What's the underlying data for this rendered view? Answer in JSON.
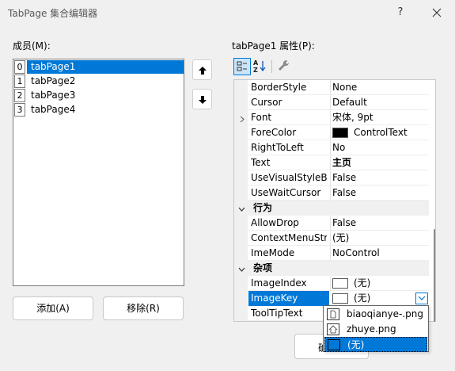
{
  "window": {
    "title": "TabPage 集合编辑器",
    "help_label": "?"
  },
  "members": {
    "label": "成员(M):",
    "items": [
      {
        "index": "0",
        "name": "tabPage1",
        "selected": true
      },
      {
        "index": "1",
        "name": "tabPage2",
        "selected": false
      },
      {
        "index": "2",
        "name": "tabPage3",
        "selected": false
      },
      {
        "index": "3",
        "name": "tabPage4",
        "selected": false
      }
    ],
    "add_label": "添加(A)",
    "remove_label": "移除(R)"
  },
  "properties": {
    "label": "tabPage1 属性(P):",
    "rows": [
      {
        "name": "BorderStyle",
        "value": "None"
      },
      {
        "name": "Cursor",
        "value": "Default"
      },
      {
        "name": "Font",
        "value": "宋体, 9pt",
        "expandable": true
      },
      {
        "name": "ForeColor",
        "value": "ControlText",
        "swatch": "#000000"
      },
      {
        "name": "RightToLeft",
        "value": "No"
      },
      {
        "name": "Text",
        "value": "主页",
        "bold": true
      },
      {
        "name": "UseVisualStyleBa",
        "value": "False"
      },
      {
        "name": "UseWaitCursor",
        "value": "False"
      },
      {
        "category": "行为"
      },
      {
        "name": "AllowDrop",
        "value": "False"
      },
      {
        "name": "ContextMenuStri",
        "value": "(无)"
      },
      {
        "name": "ImeMode",
        "value": "NoControl"
      },
      {
        "category": "杂项"
      },
      {
        "name": "ImageIndex",
        "value": "(无)",
        "swatch": "#ffffff"
      },
      {
        "name": "ImageKey",
        "value": "(无)",
        "swatch": "#ffffff",
        "selected": true,
        "dropdown": true
      },
      {
        "name": "ToolTipText",
        "value": ""
      }
    ]
  },
  "dropdown": {
    "items": [
      {
        "icon": "page-icon",
        "text": "biaoqianye-.png"
      },
      {
        "icon": "home-icon",
        "text": "zhuye.png"
      },
      {
        "icon": "none-swatch-icon",
        "text": "(无)",
        "highlighted": true
      }
    ]
  },
  "ok_button_partial": "确",
  "colors": {
    "accent": "#0078d7",
    "background": "#f0f0f0"
  }
}
